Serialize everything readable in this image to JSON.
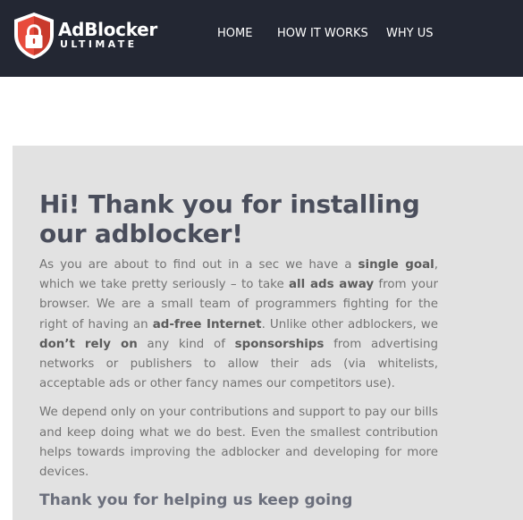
{
  "header": {
    "brand_name": "AdBlocker",
    "brand_tagline": "ULTIMATE",
    "nav": [
      "HOME",
      "HOW IT WORKS",
      "WHY US"
    ]
  },
  "colors": {
    "header_bg": "#232733",
    "shield_red": "#e84b3c",
    "card_bg": "#e2e2e2",
    "heading": "#4a4e5c",
    "body_text": "#737373"
  },
  "main": {
    "headline": "Hi! Thank you for installing our adblocker!",
    "paragraph1": {
      "p1": "As you are about to find out in a sec we have a ",
      "b1": "single goal",
      "p2": ", which we take pretty seriously – to take ",
      "b2": "all ads away",
      "p3": " from your browser. We are a small team of programmers fighting for the right of having an ",
      "b3": "ad-free Internet",
      "p4": ". Unlike other adblockers, we ",
      "b4": "don’t rely on",
      "p5": " any kind of ",
      "b5": "sponsorships",
      "p6": " from advertising networks or publishers to allow their ads (via whitelists, acceptable ads or other fancy names our competitors use)."
    },
    "paragraph2": "We depend only on your contributions and support to pay our bills and keep doing what we do best. Even the smallest contribution helps towards improving the adblocker and developing for more devices.",
    "subheading": "Thank you for helping us keep going"
  },
  "icons": {
    "logo": "lock-shield-icon"
  }
}
